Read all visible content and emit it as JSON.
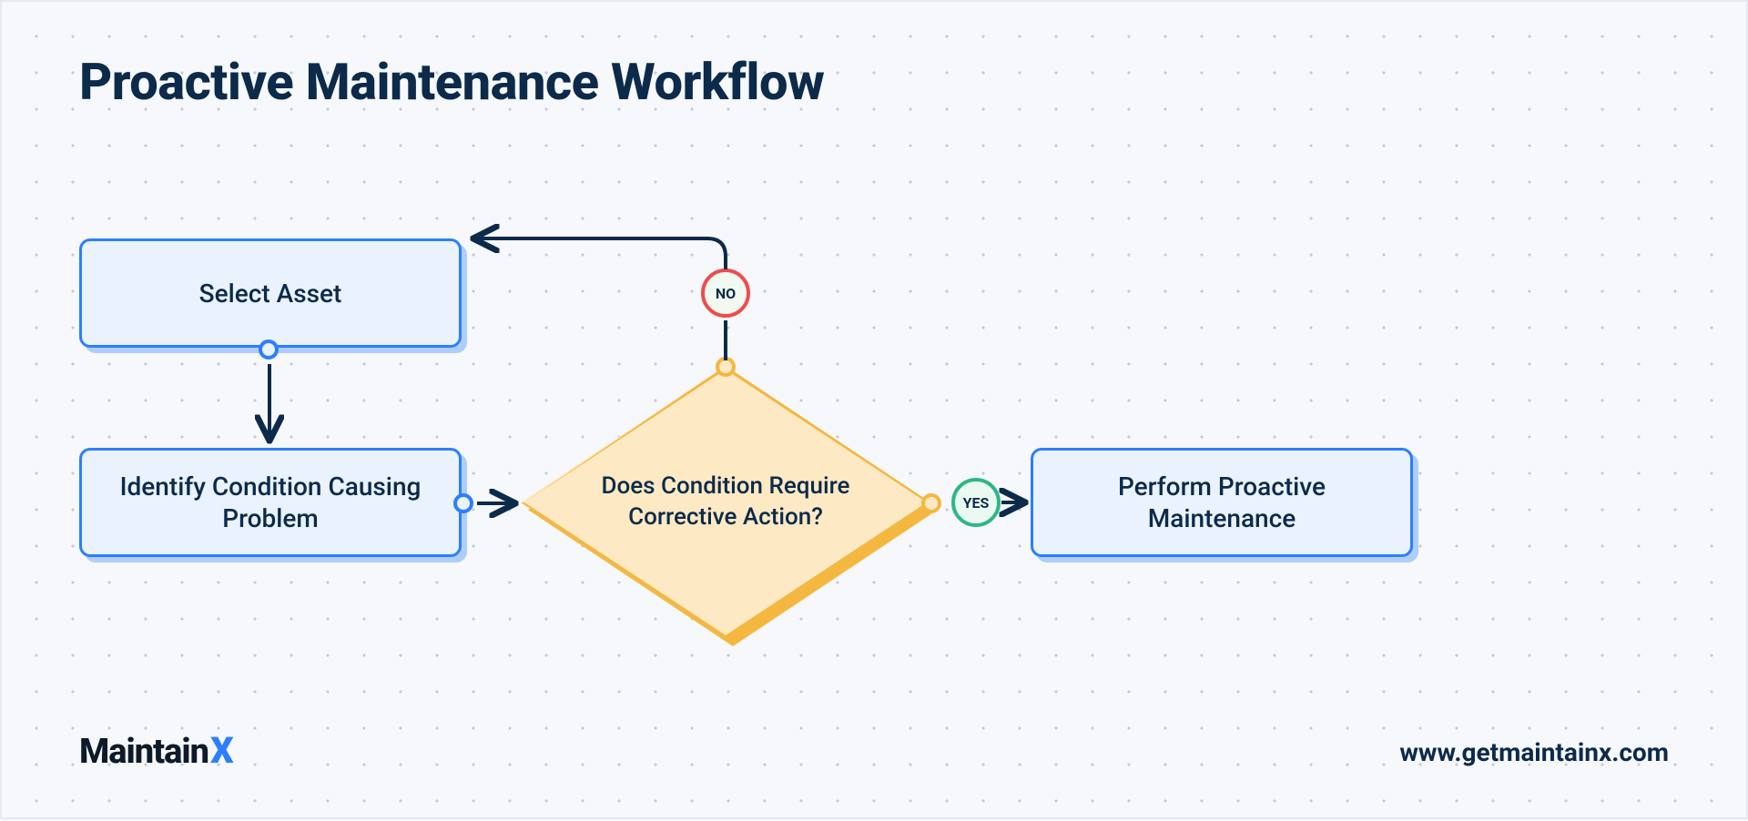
{
  "title": "Proactive Maintenance Workflow",
  "nodes": {
    "select": "Select Asset",
    "identify": "Identify Condition Causing Problem",
    "decision": "Does Condition Require Corrective Action?",
    "perform": "Perform Proactive Maintenance"
  },
  "branches": {
    "no": "NO",
    "yes": "YES"
  },
  "brand": {
    "name": "Maintain",
    "suffix": "X",
    "url": "www.getmaintainx.com"
  },
  "colors": {
    "primary": "#2b7fff",
    "amber": "#f4b73f",
    "red": "#ef4c4c",
    "green": "#2fb687",
    "navy": "#0c2a4a"
  }
}
